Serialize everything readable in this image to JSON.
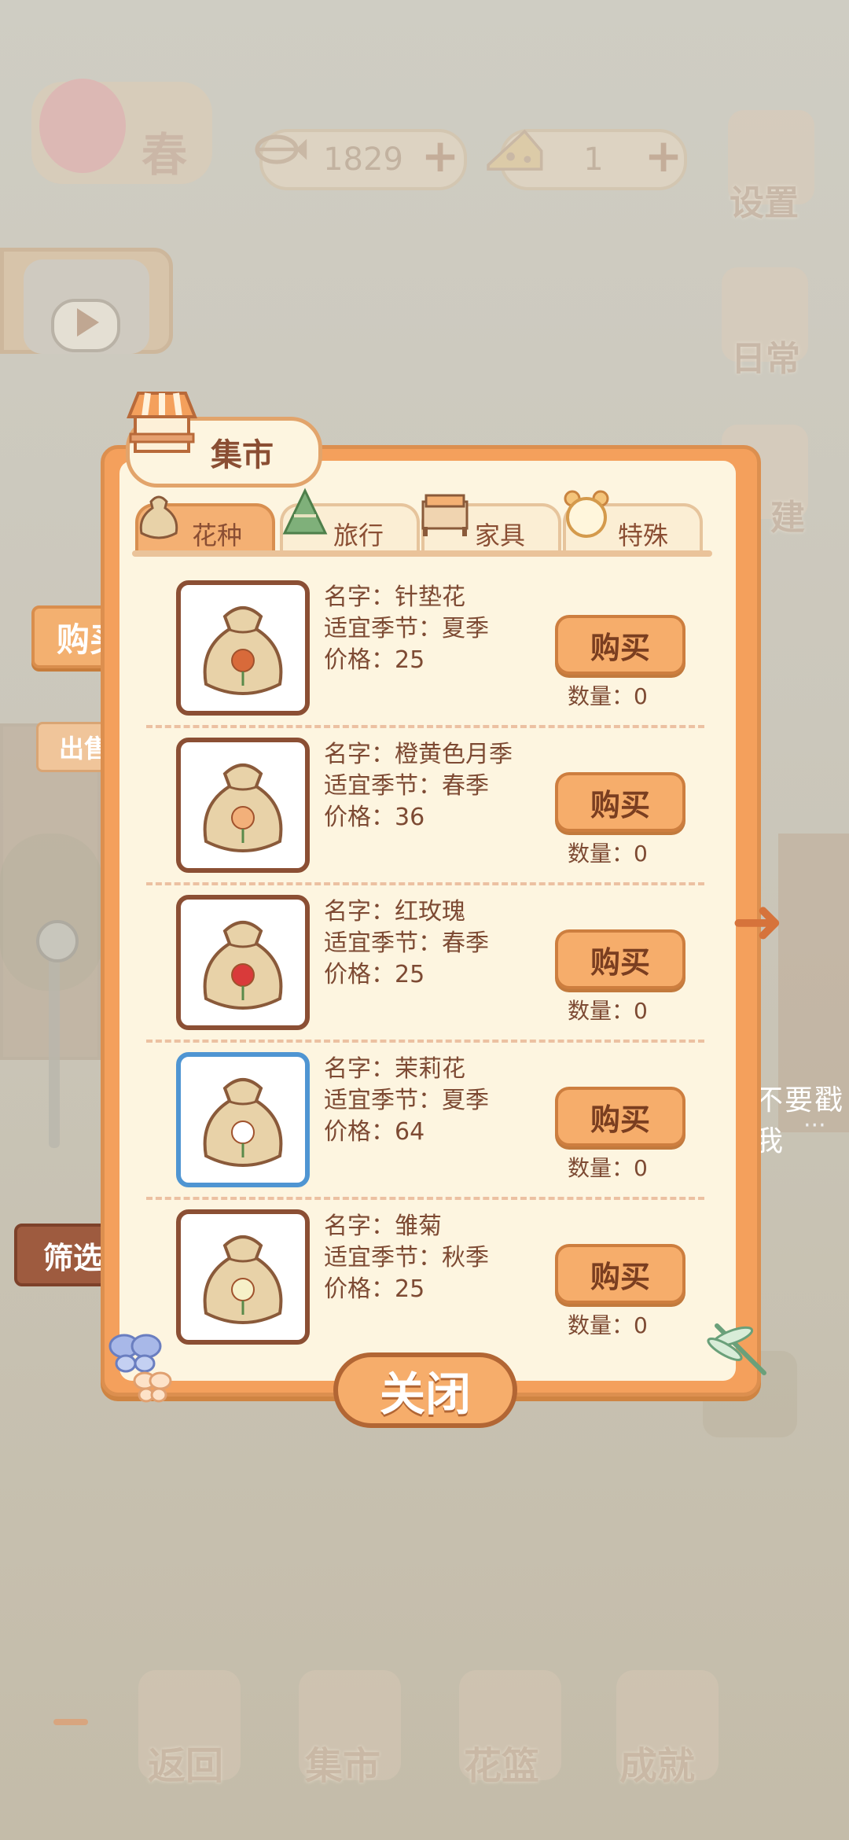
{
  "hud": {
    "season": "春",
    "fish_count": "1829",
    "cheese_count": "1",
    "settings_label": "设置",
    "daily_label": "日常",
    "build_label": "建"
  },
  "side": {
    "buy_label": "购买",
    "sell_label": "出售",
    "filter_label": "筛选",
    "right_text": "不要戳我",
    "right_dots": "···"
  },
  "panel": {
    "title": "集市",
    "tabs": [
      {
        "label": "花种",
        "icon": "seed-bag-icon",
        "active": true
      },
      {
        "label": "旅行",
        "icon": "zongzi-icon",
        "active": false
      },
      {
        "label": "家具",
        "icon": "bed-icon",
        "active": false
      },
      {
        "label": "特殊",
        "icon": "alarm-clock-icon",
        "active": false
      }
    ],
    "items": [
      {
        "name": "名字：针垫花",
        "season": "适宜季节：夏季",
        "price": "价格：25",
        "buy": "购买",
        "qty": "数量：0",
        "flower_color": "#d86a3a"
      },
      {
        "name": "名字：橙黄色月季",
        "season": "适宜季节：春季",
        "price": "价格：36",
        "buy": "购买",
        "qty": "数量：0",
        "flower_color": "#f2b07a"
      },
      {
        "name": "名字：红玫瑰",
        "season": "适宜季节：春季",
        "price": "价格：25",
        "buy": "购买",
        "qty": "数量：0",
        "flower_color": "#d93a3a"
      },
      {
        "name": "名字：茉莉花",
        "season": "适宜季节：夏季",
        "price": "价格：64",
        "buy": "购买",
        "qty": "数量：0",
        "flower_color": "#ffffff"
      },
      {
        "name": "名字：雏菊",
        "season": "适宜季节：秋季",
        "price": "价格：25",
        "buy": "购买",
        "qty": "数量：0",
        "flower_color": "#f6f0c8"
      }
    ],
    "close": "关闭"
  },
  "nav": {
    "back": "返回",
    "market": "集市",
    "basket": "花篮",
    "achievement": "成就"
  },
  "colors": {
    "panel_orange": "#f4a05c",
    "panel_cream": "#fdf5e0",
    "text_brown": "#7d4a33",
    "button_orange": "#f6ad6b"
  }
}
